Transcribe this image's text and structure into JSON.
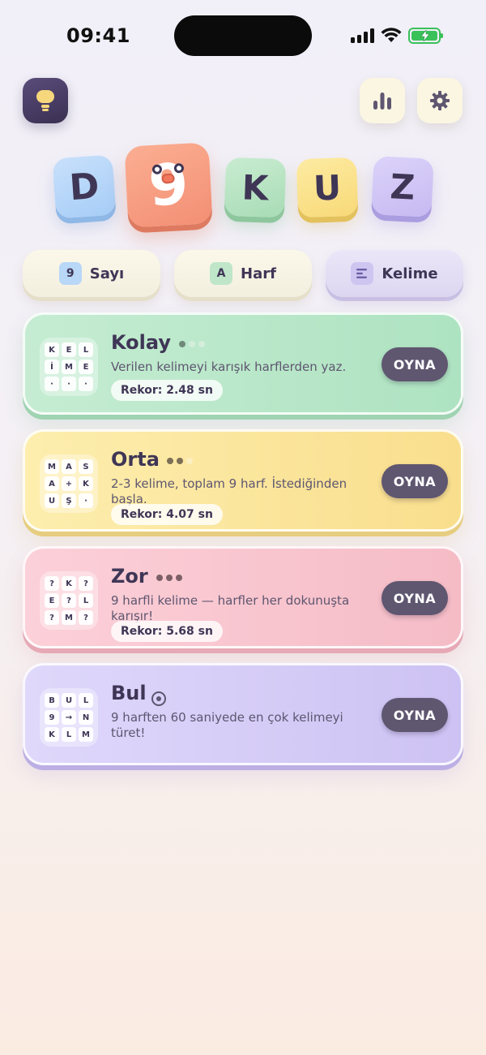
{
  "status": {
    "time": "09:41"
  },
  "logo": {
    "letters": [
      "D",
      "9",
      "K",
      "U",
      "Z"
    ]
  },
  "tabs": [
    {
      "badge": "9",
      "label": "Sayı"
    },
    {
      "badge": "A",
      "label": "Harf"
    },
    {
      "badge": "",
      "label": "Kelime"
    }
  ],
  "modes": [
    {
      "title": "Kolay",
      "description": "Verilen kelimeyi karışık harflerden yaz.",
      "record": "Rekor: 2.48 sn",
      "button": "OYNA",
      "grid": [
        "K",
        "E",
        "L",
        "İ",
        "M",
        "E",
        "·",
        "·",
        "·"
      ],
      "difficulty": 1
    },
    {
      "title": "Orta",
      "description": "2-3 kelime, toplam 9 harf. İstediğinden başla.",
      "record": "Rekor: 4.07 sn",
      "button": "OYNA",
      "grid": [
        "M",
        "A",
        "S",
        "A",
        "+",
        "K",
        "U",
        "Ş",
        "·"
      ],
      "difficulty": 2
    },
    {
      "title": "Zor",
      "description": "9 harfli kelime — harfler her dokunuşta karışır!",
      "record": "Rekor: 5.68 sn",
      "button": "OYNA",
      "grid": [
        "?",
        "K",
        "?",
        "E",
        "?",
        "L",
        "?",
        "M",
        "?"
      ],
      "difficulty": 3
    },
    {
      "title": "Bul",
      "description": "9 harften 60 saniyede en çok kelimeyi türet!",
      "button": "OYNA",
      "grid": [
        "B",
        "U",
        "L",
        "9",
        "→",
        "N",
        "K",
        "L",
        "M"
      ]
    }
  ],
  "colors": {
    "text": "#3f3656",
    "play_button": "#5f5670",
    "kolay": "#aee3c1",
    "orta": "#f9de8d",
    "zor": "#f5bcc6",
    "bul": "#cdc2f3"
  }
}
